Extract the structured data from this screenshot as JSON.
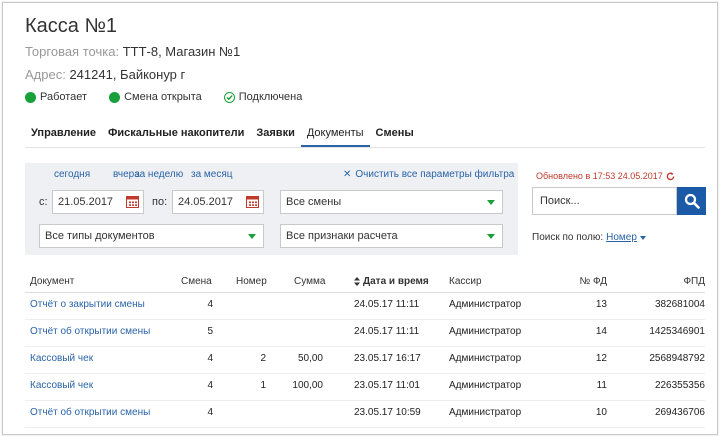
{
  "header": {
    "title": "Касса №1",
    "store_label": "Торговая точка:",
    "store_value": "ТТТ-8, Магазин №1",
    "address_label": "Адрес:",
    "address_value": "241241, Байконур г"
  },
  "statuses": [
    {
      "label": "Работает",
      "icon": "green-dot-icon",
      "color": "#18a03a"
    },
    {
      "label": "Смена открыта",
      "icon": "green-dot-icon",
      "color": "#18a03a"
    },
    {
      "label": "Подключена",
      "icon": "check-circle-icon",
      "color": "#18a03a"
    }
  ],
  "tabs": [
    {
      "label": "Управление",
      "active": false
    },
    {
      "label": "Фискальные накопители",
      "active": false
    },
    {
      "label": "Заявки",
      "active": false
    },
    {
      "label": "Документы",
      "active": true
    },
    {
      "label": "Смены",
      "active": false
    }
  ],
  "filter": {
    "quick": [
      "сегодня",
      "вчера",
      "за неделю",
      "за месяц"
    ],
    "clear_label": "Очистить все параметры фильтра",
    "from_label": "с:",
    "from_value": "21.05.2017",
    "to_label": "по:",
    "to_value": "24.05.2017",
    "shift_select": "Все смены",
    "doc_type_select": "Все типы документов",
    "calc_select": "Все признаки расчета"
  },
  "updated": "Обновлено в 17:53 24.05.2017",
  "search": {
    "placeholder": "Поиск...",
    "by_label": "Поиск по полю:",
    "by_value": "Номер"
  },
  "table": {
    "columns": [
      "Документ",
      "Смена",
      "Номер",
      "Сумма",
      "Дата и время",
      "Кассир",
      "№ ФД",
      "ФПД"
    ],
    "rows": [
      {
        "doc": "Отчёт о закрытии смены",
        "shift": "4",
        "num": "",
        "sum": "",
        "date": "24.05.17 11:11",
        "cashier": "Администратор",
        "fd": "13",
        "fpd": "382681004"
      },
      {
        "doc": "Отчёт об открытии смены",
        "shift": "5",
        "num": "",
        "sum": "",
        "date": "24.05.17 11:11",
        "cashier": "Администратор",
        "fd": "14",
        "fpd": "1425346901"
      },
      {
        "doc": "Кассовый чек",
        "shift": "4",
        "num": "2",
        "sum": "50,00",
        "date": "23.05.17 16:17",
        "cashier": "Администратор",
        "fd": "12",
        "fpd": "2568948792"
      },
      {
        "doc": "Кассовый чек",
        "shift": "4",
        "num": "1",
        "sum": "100,00",
        "date": "23.05.17 11:01",
        "cashier": "Администратор",
        "fd": "11",
        "fpd": "226355356"
      },
      {
        "doc": "Отчёт об открытии смены",
        "shift": "4",
        "num": "",
        "sum": "",
        "date": "23.05.17 10:59",
        "cashier": "Администратор",
        "fd": "10",
        "fpd": "269436706"
      }
    ]
  },
  "colors": {
    "accent": "#2a63a8",
    "search_button": "#1a5aa6",
    "status_green": "#18a03a",
    "updated_red": "#c0392b",
    "filter_bg": "#eef0f3"
  }
}
